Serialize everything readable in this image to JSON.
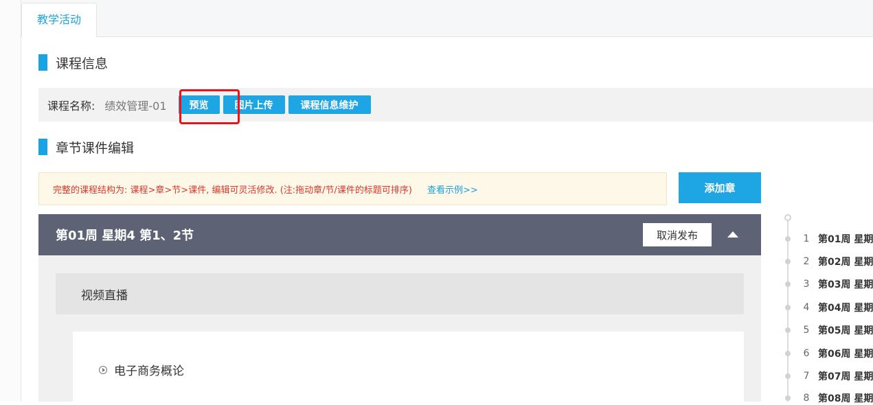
{
  "tabs": {
    "active": "教学活动"
  },
  "course_info": {
    "heading": "课程信息",
    "name_label": "课程名称:",
    "name_value": "绩效管理-01",
    "buttons": {
      "preview": "预览",
      "upload_image": "图片上传",
      "maintain": "课程信息维护"
    }
  },
  "chapter_edit": {
    "heading": "章节课件编辑",
    "notice": "完整的课程结构为: 课程>章>节>课件, 编辑可灵活修改. (注:拖动章/节/课件的标题可排序)",
    "notice_link": "查看示例>>",
    "add_chapter": "添加章"
  },
  "chapter": {
    "title": "第01周 星期4 第1、2节",
    "cancel_publish": "取消发布",
    "section": {
      "title": "视频直播"
    },
    "course_item": "电子商务概论"
  },
  "timeline": {
    "items": [
      {
        "num": "1",
        "label": "第01周 星期"
      },
      {
        "num": "2",
        "label": "第02周 星期"
      },
      {
        "num": "3",
        "label": "第03周 星期"
      },
      {
        "num": "4",
        "label": "第04周 星期"
      },
      {
        "num": "5",
        "label": "第05周 星期"
      },
      {
        "num": "6",
        "label": "第06周 星期"
      },
      {
        "num": "7",
        "label": "第07周 星期"
      },
      {
        "num": "8",
        "label": "第08周 星期"
      }
    ]
  },
  "colors": {
    "accent": "#1ea5e3",
    "chapter_header": "#5d6374",
    "notice_text": "#d9382c",
    "highlight_box": "#e8141b"
  }
}
